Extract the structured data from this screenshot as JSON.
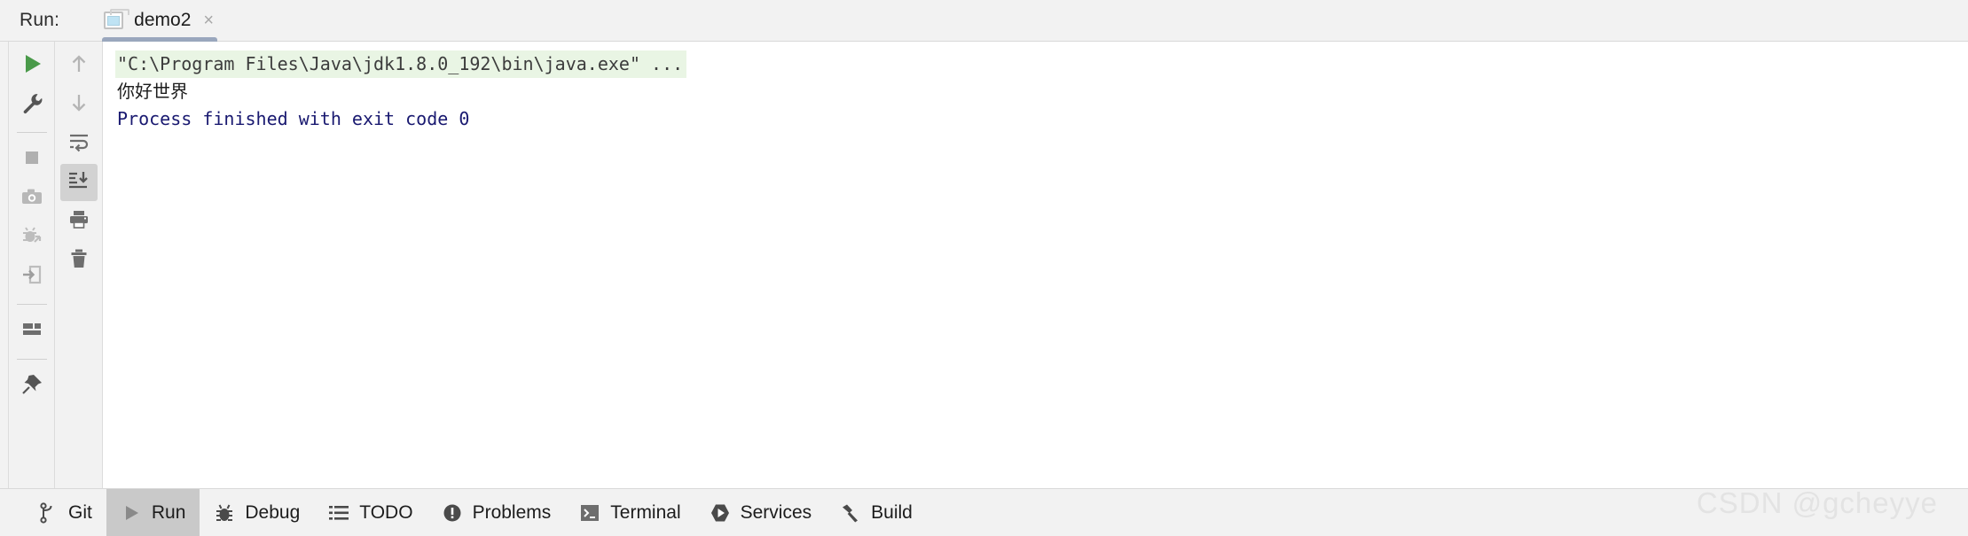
{
  "window": {
    "run_label": "Run:",
    "tab": {
      "title": "demo2",
      "icon": "run-configuration-icon",
      "close_label": "×"
    }
  },
  "left_toolbar": {
    "items": [
      {
        "name": "rerun-button",
        "icon": "play-icon",
        "tooltip": "Rerun"
      },
      {
        "name": "edit-configurations-button",
        "icon": "wrench-icon",
        "tooltip": "Modify Run Configuration"
      },
      {
        "name": "stop-button",
        "icon": "stop-square-icon",
        "tooltip": "Stop"
      },
      {
        "name": "snapshot-button",
        "icon": "camera-icon",
        "tooltip": "Capture Memory Snapshot"
      },
      {
        "name": "attach-debugger-button",
        "icon": "bug-arrow-icon",
        "tooltip": "Attach Debugger"
      },
      {
        "name": "thread-dump-button",
        "icon": "export-arrow-icon",
        "tooltip": "Get Thread Dump"
      },
      {
        "name": "layout-button",
        "icon": "layout-grid-icon",
        "tooltip": "Layout Settings"
      },
      {
        "name": "pin-tab-button",
        "icon": "pin-icon",
        "tooltip": "Pin Tab"
      }
    ]
  },
  "console_toolbar": {
    "items": [
      {
        "name": "prev-occurrence-button",
        "icon": "arrow-up-icon",
        "tooltip": "Up the Stack Trace"
      },
      {
        "name": "next-occurrence-button",
        "icon": "arrow-down-icon",
        "tooltip": "Down the Stack Trace"
      },
      {
        "name": "soft-wrap-button",
        "icon": "soft-wrap-icon",
        "tooltip": "Soft-Wrap"
      },
      {
        "name": "scroll-to-end-button",
        "icon": "scroll-to-end-icon",
        "tooltip": "Scroll to the End",
        "active": true
      },
      {
        "name": "print-button",
        "icon": "printer-icon",
        "tooltip": "Print"
      },
      {
        "name": "clear-all-button",
        "icon": "trash-icon",
        "tooltip": "Clear All"
      }
    ]
  },
  "console": {
    "lines": [
      {
        "text": "\"C:\\Program Files\\Java\\jdk1.8.0_192\\bin\\java.exe\" ...",
        "style": "cmd"
      },
      {
        "text": "你好世界",
        "style": "zh"
      },
      {
        "text": "Process finished with exit code 0",
        "style": "finish"
      }
    ]
  },
  "status_bar": {
    "items": [
      {
        "name": "status-git",
        "label": "Git",
        "icon": "branch-icon",
        "active": false
      },
      {
        "name": "status-run",
        "label": "Run",
        "icon": "play-icon",
        "active": true
      },
      {
        "name": "status-debug",
        "label": "Debug",
        "icon": "bug-icon",
        "active": false
      },
      {
        "name": "status-todo",
        "label": "TODO",
        "icon": "list-icon",
        "active": false
      },
      {
        "name": "status-problems",
        "label": "Problems",
        "icon": "exclamation-circle-icon",
        "active": false
      },
      {
        "name": "status-terminal",
        "label": "Terminal",
        "icon": "terminal-icon",
        "active": false
      },
      {
        "name": "status-services",
        "label": "Services",
        "icon": "play-hexagon-icon",
        "active": false
      },
      {
        "name": "status-build",
        "label": "Build",
        "icon": "hammer-icon",
        "active": false
      }
    ]
  },
  "watermark": {
    "text": "CSDN @gcheyye"
  },
  "colors": {
    "accent_green": "#4a9a4a",
    "cmd_highlight_bg": "#e9f5e4",
    "finish_text": "#191970",
    "chrome_bg": "#f2f2f2",
    "tab_underline": "#9aa7bd",
    "selected_bg": "#c9c9c9"
  }
}
